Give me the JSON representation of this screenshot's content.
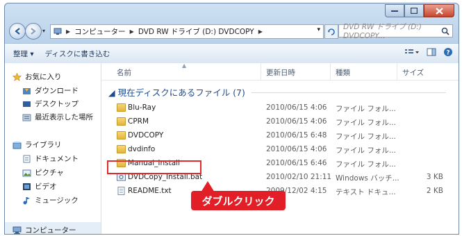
{
  "address": {
    "segments": [
      "コンピューター",
      "DVD RW ドライブ (D:) DVDCOPY"
    ],
    "search_placeholder": "DVD RW ドライブ (D:) DVDCOPY..."
  },
  "toolbar": {
    "organize_label": "整理 ▾",
    "burn_label": "ディスクに書き込む"
  },
  "sidebar": {
    "favorites_label": "お気に入り",
    "items_fav": [
      "ダウンロード",
      "デスクトップ",
      "最近表示した場所"
    ],
    "libraries_label": "ライブラリ",
    "items_lib": [
      "ドキュメント",
      "ピクチャ",
      "ビデオ",
      "ミュージック"
    ],
    "computer_label": "コンピューター"
  },
  "columns": {
    "name": "名前",
    "date": "更新日時",
    "type": "種類",
    "size": "サイズ"
  },
  "group_label": "◢ 現在ディスクにあるファイル (7)",
  "files": [
    {
      "name": "Blu-Ray",
      "date": "2010/06/15 4:06",
      "type": "ファイル フォル...",
      "size": "",
      "kind": "folder"
    },
    {
      "name": "CPRM",
      "date": "2010/06/15 4:06",
      "type": "ファイル フォル...",
      "size": "",
      "kind": "folder"
    },
    {
      "name": "DVDCOPY",
      "date": "2010/06/15 6:48",
      "type": "ファイル フォル...",
      "size": "",
      "kind": "folder"
    },
    {
      "name": "dvdinfo",
      "date": "2010/06/15 4:06",
      "type": "ファイル フォル...",
      "size": "",
      "kind": "folder"
    },
    {
      "name": "Manual_Install",
      "date": "2010/06/15 6:46",
      "type": "ファイル フォル...",
      "size": "",
      "kind": "folder"
    },
    {
      "name": "DVDCopy_Install.bat",
      "date": "2010/02/10 21:11",
      "type": "Windows バッチ...",
      "size": "3 KB",
      "kind": "bat"
    },
    {
      "name": "README.txt",
      "date": "2009/12/02 4:15",
      "type": "テキスト ドキュ...",
      "size": "2 KB",
      "kind": "txt"
    }
  ],
  "callout_label": "ダブルクリック",
  "colors": {
    "callout": "#e21f26",
    "group": "#1e4c8f",
    "folder": "#e8bd4a"
  }
}
